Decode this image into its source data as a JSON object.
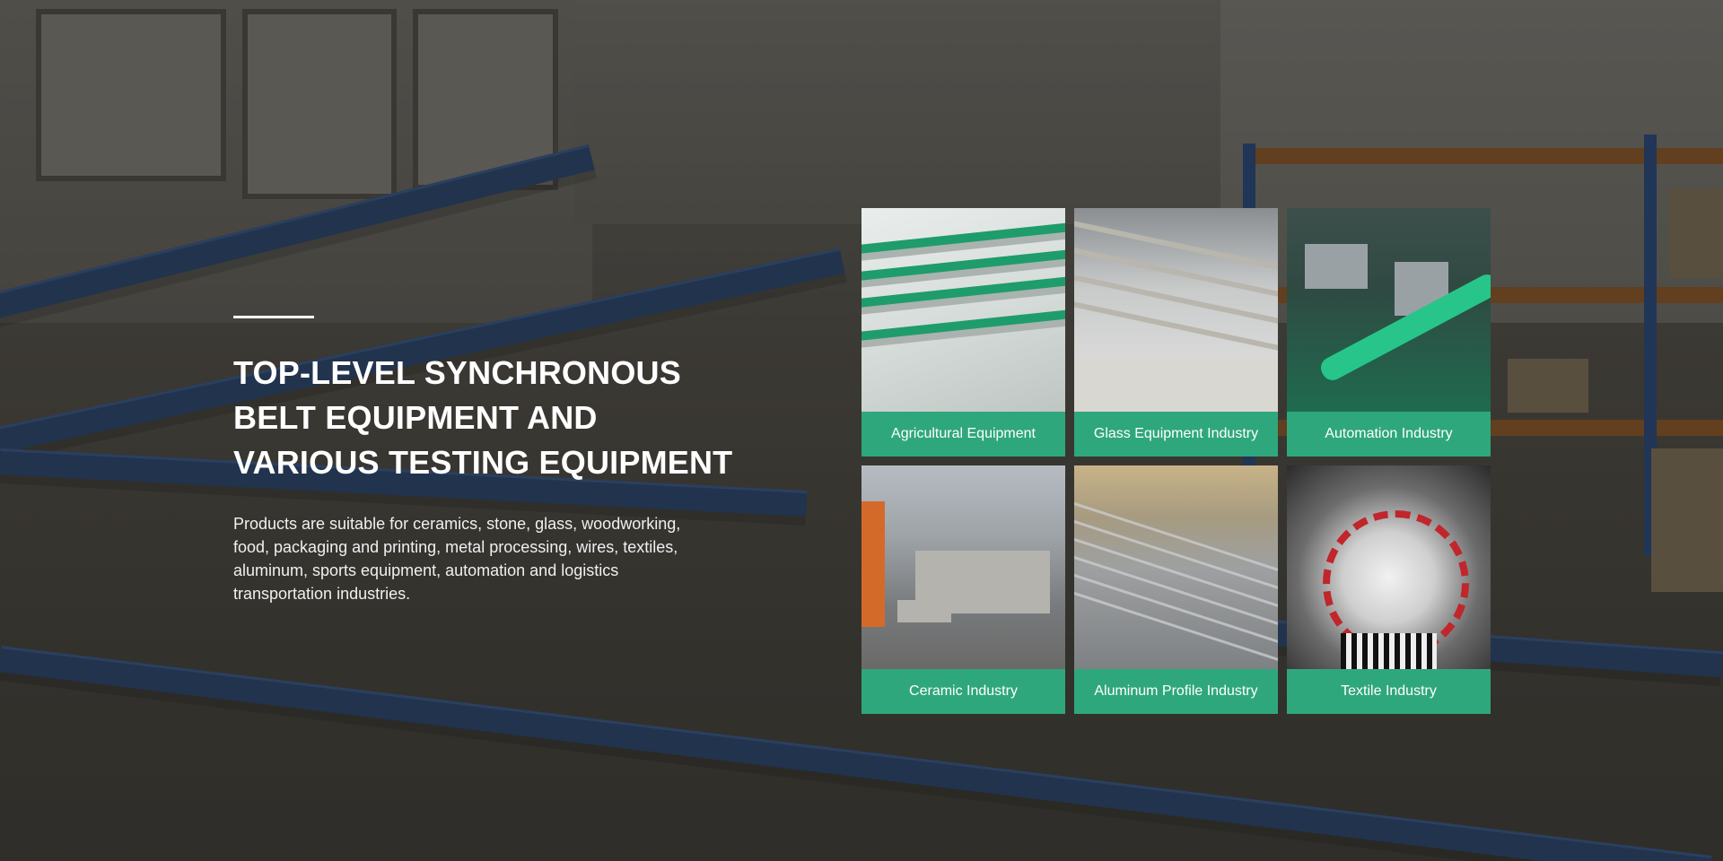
{
  "intro": {
    "heading": "TOP-LEVEL SYNCHRONOUS BELT EQUIPMENT AND VARIOUS TESTING EQUIPMENT",
    "heading_lines": [
      "TOP-LEVEL SYNCHRONOUS",
      "BELT EQUIPMENT AND",
      "VARIOUS TESTING EQUIPMENT"
    ],
    "description": "Products are suitable for ceramics, stone, glass, woodworking, food, packaging and printing, metal processing, wires, textiles, aluminum, sports equipment, automation and logistics transportation industries."
  },
  "categories": [
    {
      "label": "Agricultural Equipment"
    },
    {
      "label": "Glass Equipment Industry"
    },
    {
      "label": "Automation Industry"
    },
    {
      "label": "Ceramic Industry"
    },
    {
      "label": "Aluminum Profile Industry"
    },
    {
      "label": "Textile Industry"
    }
  ],
  "colors": {
    "accent": "#2fa77c",
    "text": "#ffffff",
    "overlay": "rgba(20,18,15,0.42)"
  }
}
